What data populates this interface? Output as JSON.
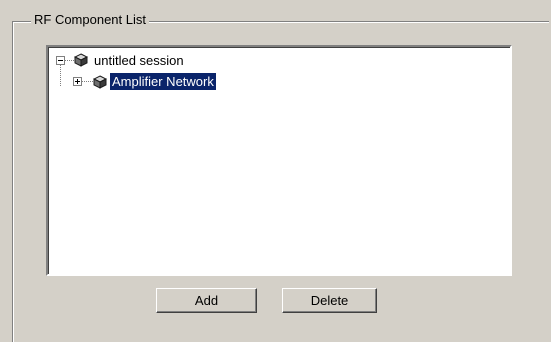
{
  "group": {
    "title": "RF Component List"
  },
  "tree": {
    "root": {
      "label": "untitled session",
      "expanded": true,
      "icon": "package-cube-icon"
    },
    "children": [
      {
        "label": "Amplifier Network",
        "expanded": false,
        "selected": true,
        "icon": "package-cube-icon"
      }
    ]
  },
  "buttons": {
    "add_label": "Add",
    "delete_label": "Delete"
  },
  "colors": {
    "background": "#d4d0c8",
    "selection": "#0a246a",
    "selection_text": "#ffffff",
    "tree_background": "#ffffff"
  }
}
